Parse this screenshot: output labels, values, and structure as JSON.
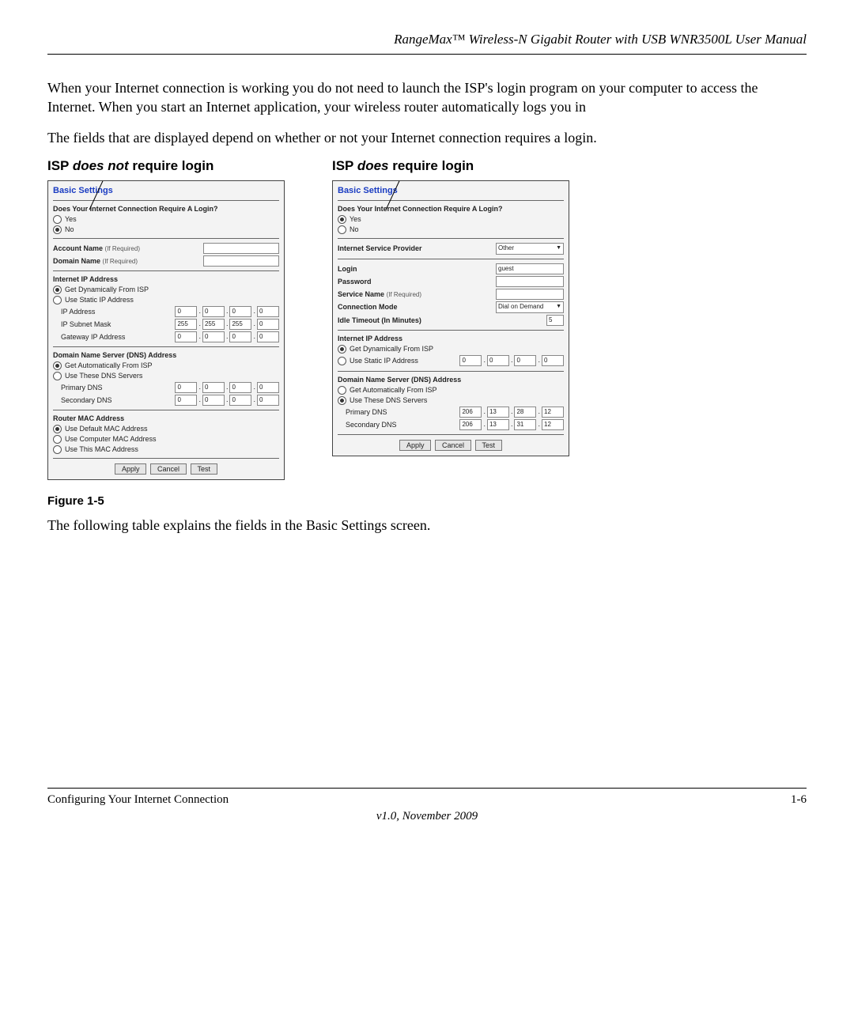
{
  "header": "RangeMax™ Wireless-N Gigabit Router with USB WNR3500L User Manual",
  "para1": "When your Internet connection is working you do not need to launch the ISP's login program on your computer to access the Internet. When you start an Internet application, your wireless router automatically logs you in",
  "para2": "The fields that are displayed depend on whether or not your Internet connection requires a login.",
  "left_heading_pre": "ISP ",
  "left_heading_em": "does not",
  "left_heading_post": " require login",
  "right_heading_pre": "ISP ",
  "right_heading_em": "does",
  "right_heading_post": " require login",
  "panel_title": "Basic Settings",
  "q_login": "Does Your Internet Connection Require A Login?",
  "yes": "Yes",
  "no": "No",
  "acct_label": "Account Name",
  "if_req": "(If Required)",
  "domain_label": "Domain Name",
  "iip": "Internet IP Address",
  "get_dyn": "Get Dynamically From ISP",
  "use_static": "Use Static IP Address",
  "ip_addr": "IP Address",
  "subnet": "IP Subnet Mask",
  "gateway": "Gateway IP Address",
  "dns_title": "Domain Name Server (DNS) Address",
  "get_auto": "Get Automatically From ISP",
  "use_dns": "Use These DNS Servers",
  "pdns": "Primary DNS",
  "sdns": "Secondary DNS",
  "mac_title": "Router MAC Address",
  "mac_def": "Use Default MAC Address",
  "mac_comp": "Use Computer MAC Address",
  "mac_this": "Use This MAC Address",
  "apply": "Apply",
  "cancel": "Cancel",
  "test": "Test",
  "isp_label": "Internet Service Provider",
  "isp_value": "Other",
  "login_label": "Login",
  "login_value": "guest",
  "pw_label": "Password",
  "svc_label": "Service Name",
  "conn_label": "Connection Mode",
  "conn_value": "Dial on Demand",
  "idle_label": "Idle Timeout (In Minutes)",
  "idle_value": "5",
  "zero": "0",
  "v255": "255",
  "d206": "206",
  "d13": "13",
  "d28": "28",
  "d31": "31",
  "d12": "12",
  "figure": "Figure 1-5",
  "para3": "The following table explains the fields in the Basic Settings screen.",
  "footer_left": "Configuring Your Internet Connection",
  "footer_right": "1-6",
  "footer_center": "v1.0, November 2009"
}
